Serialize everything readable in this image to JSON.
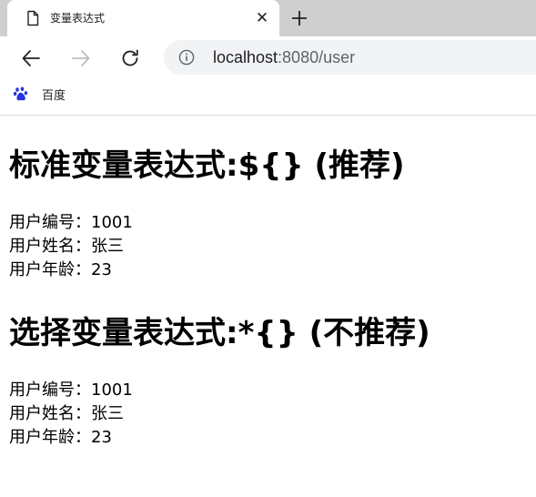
{
  "browser": {
    "tab": {
      "title": "变量表达式",
      "favicon": "page-icon",
      "close_label": "✕"
    },
    "new_tab_icon": "plus-icon",
    "nav": {
      "back_icon": "back-arrow-icon",
      "forward_icon": "forward-arrow-icon",
      "reload_icon": "reload-icon"
    },
    "address_bar": {
      "info_icon": "info-icon",
      "host": "localhost",
      "rest": ":8080/user"
    },
    "bookmarks": [
      {
        "icon": "baidu-paw-icon",
        "label": "百度"
      }
    ],
    "colors": {
      "tab_strip": "#cfcfcf",
      "omnibox": "#f1f3f4",
      "baidu_blue": "#2932e1"
    }
  },
  "page": {
    "section1": {
      "heading": "标准变量表达式:${} (推荐)",
      "lines": [
        "用户编号：1001",
        "用户姓名：张三",
        "用户年龄：23"
      ]
    },
    "section2": {
      "heading": "选择变量表达式:*{} (不推荐)",
      "lines": [
        "用户编号：1001",
        "用户姓名：张三",
        "用户年龄：23"
      ]
    }
  }
}
